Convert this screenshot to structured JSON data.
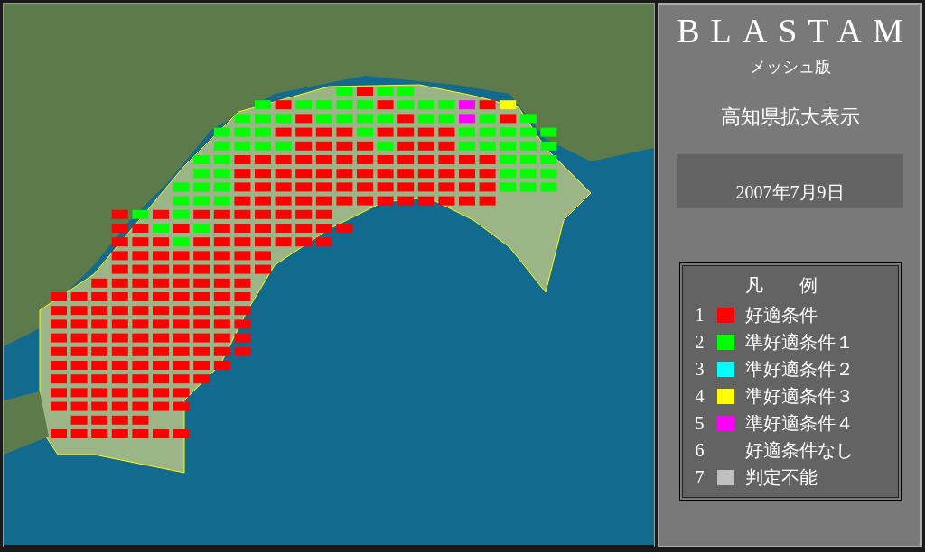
{
  "title": "BLASTAM",
  "subtitle": "メッシュ版",
  "area": "高知県拡大表示",
  "date": "2007年7月9日",
  "legend": {
    "title": "凡　　例",
    "items": [
      {
        "number": "1",
        "label": "好適条件",
        "color": "#ff0000"
      },
      {
        "number": "2",
        "label": "準好適条件１",
        "color": "#00ff00"
      },
      {
        "number": "3",
        "label": "準好適条件２",
        "color": "#00ffff"
      },
      {
        "number": "4",
        "label": "準好適条件３",
        "color": "#ffff00"
      },
      {
        "number": "5",
        "label": "準好適条件４",
        "color": "#ff00ff"
      },
      {
        "number": "6",
        "label": "好適条件なし"
      },
      {
        "number": "7",
        "label": "判定不能",
        "color": "#c0c0c0"
      }
    ]
  }
}
